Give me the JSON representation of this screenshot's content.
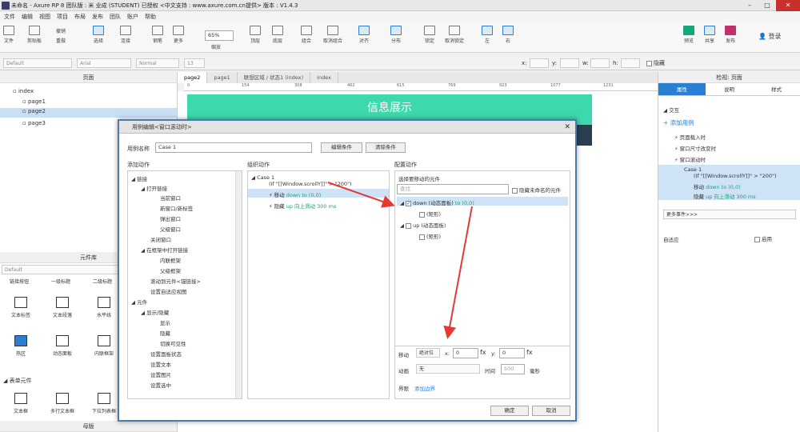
{
  "window": {
    "title": "未命名 - Axure RP 8 团队版 : 米 业成 (STUDENT) 已授权   <中文支持 : www.axure.com.cn提供> 版本 : V1.4.3"
  },
  "menu": [
    "文件",
    "编辑",
    "视图",
    "项目",
    "布局",
    "发布",
    "团队",
    "账户",
    "帮助"
  ],
  "toolbar": {
    "file": "文件",
    "clipboard": "剪贴板",
    "undo": "撤销",
    "redo": "重做",
    "select": "选择",
    "connect": "连接",
    "pen": "钢笔",
    "more": "更多",
    "zoom": "65%",
    "zoom_label": "缩放",
    "top": "顶层",
    "bottom": "底层",
    "group": "组合",
    "ungroup": "取消组合",
    "align": "对齐",
    "distribute": "分布",
    "lock": "锁定",
    "unlock": "取消锁定",
    "left": "左",
    "right": "右",
    "preview": "预览",
    "share": "共享",
    "publish": "发布",
    "login": "登录"
  },
  "format": {
    "style": "Default",
    "font": "Arial",
    "weight": "Normal",
    "size": "13",
    "x": "x:",
    "y": "y:",
    "w": "w:",
    "h": "h:",
    "hide": "隐藏"
  },
  "pages": {
    "header": "页面",
    "items": [
      "index",
      "page1",
      "page2",
      "page3"
    ]
  },
  "library": {
    "header": "元件库",
    "select": "Default",
    "row0": [
      "链接按钮",
      "一级标题",
      "二级标题"
    ],
    "row1": [
      "文本标签",
      "文本段落",
      "水平线"
    ],
    "row2": [
      "热区",
      "动态面板",
      "内联框架"
    ],
    "section": "表单元件",
    "row3": [
      "文本框",
      "多行文本框",
      "下拉列表框"
    ],
    "master": "母版"
  },
  "doc_tabs": [
    "page2",
    "page1",
    "联想区域 / 状态1 (index)",
    "index"
  ],
  "ruler": [
    "0",
    "154",
    "308",
    "462",
    "615",
    "769",
    "923",
    "1077",
    "1231"
  ],
  "canvas": {
    "banner": "信息展示"
  },
  "inspector": {
    "header": "检视: 页面",
    "tabs": [
      "属性",
      "说明",
      "样式"
    ],
    "section": "交互",
    "add": "添加用例",
    "events": [
      "页面载入时",
      "窗口尺寸改变时",
      "窗口滚动时"
    ],
    "case": "Case 1",
    "condition": "(If \"[[Window.scrollY]]\" > \"200\")",
    "actions": [
      {
        "verb": "移动",
        "detail": "down to (0,0)"
      },
      {
        "verb": "隐藏",
        "detail": "up 向上滑动 300 ms"
      }
    ],
    "more_events": "更多事件>>>",
    "adaptive": "自适应",
    "enable": "启用"
  },
  "dialog": {
    "title": "用例编辑<窗口滚动时>",
    "case_name_label": "用例名称",
    "case_name": "Case 1",
    "edit_cond": "编辑条件",
    "clear_cond": "清除条件",
    "col1": "添加动作",
    "col2": "组织动作",
    "col3": "配置动作",
    "actions_tree": [
      "链接",
      "打开链接",
      "当前窗口",
      "新窗口/新标签",
      "弹出窗口",
      "父级窗口",
      "关闭窗口",
      "在框架中打开链接",
      "内联框架",
      "父级框架",
      "滚动到元件<锚链接>",
      "设置自适应视图",
      "元件",
      "显示/隐藏",
      "显示",
      "隐藏",
      "切换可见性",
      "设置面板状态",
      "设置文本",
      "设置图片",
      "设置选中"
    ],
    "org_case": "Case 1",
    "org_cond": "(If \"[[Window.scrollY]]\" > \"200\")",
    "org_actions": [
      {
        "verb": "移动",
        "detail": "down to (0,0)"
      },
      {
        "verb": "隐藏",
        "detail": "up 向上滑动 300 ms"
      }
    ],
    "select_label": "选择要移动的元件",
    "search_placeholder": "查找",
    "hide_unnamed": "隐藏未命名的元件",
    "widgets": [
      {
        "name": "down (动态面板)",
        "extra": "to (0,0)",
        "checked": true
      },
      {
        "name": "(矩形)"
      },
      {
        "name": "up (动态面板)"
      },
      {
        "name": "(矩形)"
      }
    ],
    "move_label": "移动",
    "move_mode": "绝对位",
    "x_label": "x:",
    "x_value": "0",
    "y_label": "y:",
    "y_value": "0",
    "fx": "fx",
    "anim_label": "动画",
    "anim_value": "无",
    "time_label": "时间",
    "time_value": "500",
    "ms": "毫秒",
    "bound_label": "界限",
    "bound_link": "添加边界",
    "ok": "确定",
    "cancel": "取消"
  }
}
